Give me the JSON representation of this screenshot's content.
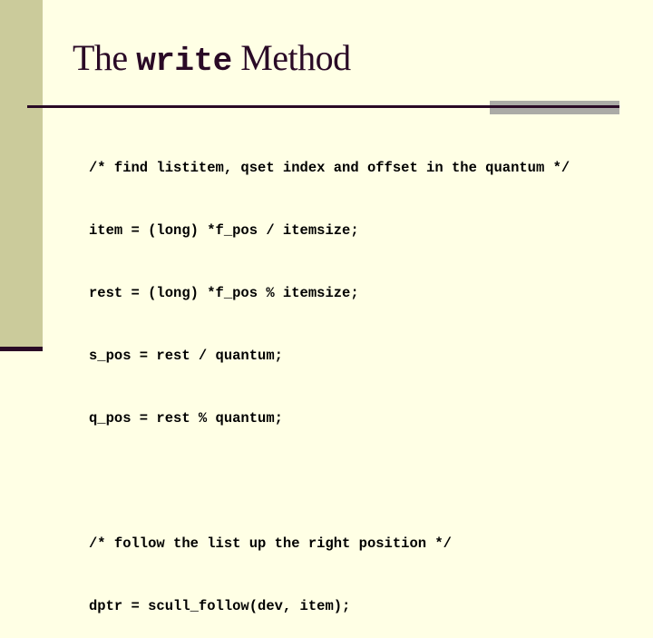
{
  "title": {
    "prefix": "The ",
    "code": "write",
    "suffix": " Method"
  },
  "code_lines": [
    "/* find listitem, qset index and offset in the quantum */",
    "item = (long) *f_pos / itemsize;",
    "rest = (long) *f_pos % itemsize;",
    "s_pos = rest / quantum;",
    "q_pos = rest % quantum;",
    "",
    "/* follow the list up the right position */",
    "dptr = scull_follow(dev, item);"
  ],
  "colors": {
    "background": "#ffffe5",
    "sidebar": "#cbcb9b",
    "accent_dark": "#2a0a26",
    "accent_gray": "#ababa6"
  }
}
